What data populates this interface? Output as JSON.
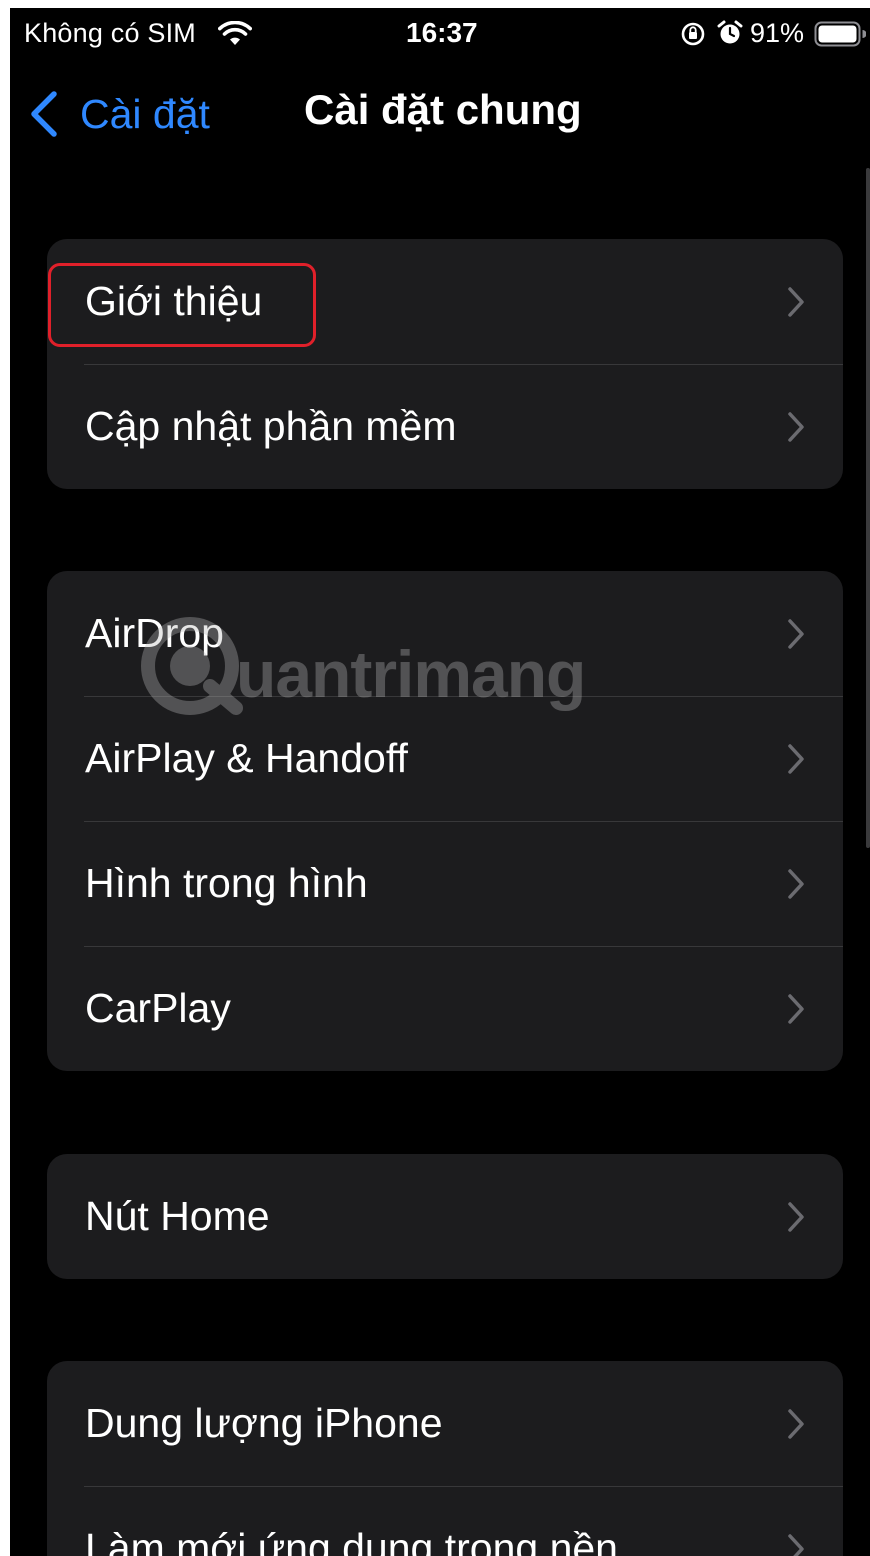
{
  "status_bar": {
    "carrier": "Không có SIM",
    "time": "16:37",
    "battery_percent": "91%",
    "icons": [
      "wifi-icon",
      "lock-rotation-icon",
      "alarm-icon",
      "battery-icon"
    ]
  },
  "nav": {
    "back_label": "Cài đặt",
    "title": "Cài đặt chung",
    "accent_color": "#2f88ff"
  },
  "groups": [
    {
      "items": [
        {
          "label": "Giới thiệu",
          "highlighted": true
        },
        {
          "label": "Cập nhật phần mềm"
        }
      ]
    },
    {
      "items": [
        {
          "label": "AirDrop"
        },
        {
          "label": "AirPlay & Handoff"
        },
        {
          "label": "Hình trong hình"
        },
        {
          "label": "CarPlay"
        }
      ]
    },
    {
      "items": [
        {
          "label": "Nút Home"
        }
      ]
    },
    {
      "items": [
        {
          "label": "Dung lượng iPhone"
        },
        {
          "label": "Làm mới ứng dụng trong nền"
        }
      ]
    }
  ],
  "watermark": {
    "text": "uantrimang"
  },
  "colors": {
    "background": "#000000",
    "cell": "#1c1c1e",
    "separator": "#38383a",
    "highlight_border": "#e0202a"
  }
}
